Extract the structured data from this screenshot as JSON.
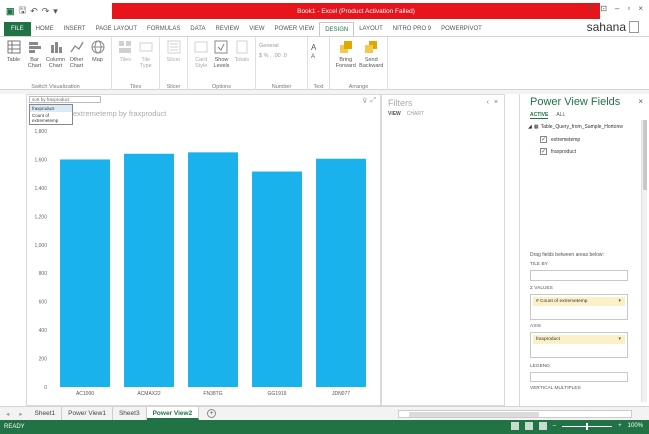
{
  "window": {
    "qat_icons": [
      "excel-icon",
      "save-icon",
      "undo-icon",
      "redo-icon"
    ],
    "title": "Book1 - Excel (Product Activation Failed)",
    "controls": [
      "?",
      "⊡",
      "–",
      "🗗",
      "×"
    ]
  },
  "tabs": [
    "FILE",
    "HOME",
    "INSERT",
    "PAGE LAYOUT",
    "FORMULAS",
    "DATA",
    "REVIEW",
    "VIEW",
    "POWER VIEW",
    "DESIGN",
    "LAYOUT",
    "NITRO PRO 9",
    "POWERPIVOT"
  ],
  "active_tab": "DESIGN",
  "user": "sahana",
  "ribbon": {
    "switch_visualization": {
      "name": "Switch Visualization",
      "buttons": [
        {
          "label": "Table",
          "sub": ""
        },
        {
          "label": "Bar",
          "sub": "Chart"
        },
        {
          "label": "Column",
          "sub": "Chart"
        },
        {
          "label": "Other",
          "sub": "Chart"
        },
        {
          "label": "Map",
          "sub": ""
        }
      ]
    },
    "tiles": {
      "name": "Tiles",
      "buttons": [
        {
          "label": "Tiles",
          "sub": ""
        },
        {
          "label": "Tile",
          "sub": "Type"
        }
      ]
    },
    "slicer": {
      "name": "Slicer",
      "buttons": [
        {
          "label": "Slicer",
          "sub": ""
        }
      ]
    },
    "options": {
      "name": "Options",
      "buttons": [
        {
          "label": "Card",
          "sub": "Style"
        },
        {
          "label": "Show",
          "sub": "Levels"
        },
        {
          "label": "Totals",
          "sub": ""
        }
      ]
    },
    "number": {
      "name": "Number",
      "format": "General",
      "symbols": "$ % , .00 .0"
    },
    "text": {
      "name": "Text",
      "grow": "A",
      "shrink": "A"
    },
    "arrange": {
      "name": "Arrange",
      "buttons": [
        {
          "label": "Bring",
          "sub": "Forward"
        },
        {
          "label": "Send",
          "sub": "Backward"
        }
      ]
    }
  },
  "canvas": {
    "sort_dropdown": "sort by fraxproduct",
    "sort_menu": [
      "fraxproduct",
      "Count of extremetemp"
    ],
    "chart_title": "extremetemp by fraxproduct",
    "icons": [
      "filter-icon",
      "popout-icon"
    ]
  },
  "chart_data": {
    "type": "bar",
    "categories": [
      "AC1000",
      "ACMAX22",
      "FN38TG",
      "GG1919",
      "JDN077"
    ],
    "values": [
      1600,
      1640,
      1650,
      1515,
      1605
    ],
    "title": "extremetemp by fraxproduct",
    "xlabel": "",
    "ylabel": "",
    "ylim": [
      0,
      1800
    ],
    "yticks": [
      "0",
      "200",
      "400",
      "600",
      "800",
      "1,000",
      "1,200",
      "1,400",
      "1,600",
      "1,800"
    ],
    "color": "#1ab2ec",
    "grid": false
  },
  "filters": {
    "title": "Filters",
    "view": "VIEW",
    "chart": "CHART",
    "controls": [
      "‹",
      "×"
    ]
  },
  "fields": {
    "title": "Power View Fields",
    "tab_active": "ACTIVE",
    "tab_all": "ALL",
    "table": "Table_Query_from_Sample_Hortonw",
    "items": [
      {
        "name": "extremetemp",
        "checked": true
      },
      {
        "name": "fraxproduct",
        "checked": true
      }
    ],
    "drag_hint": "Drag fields between areas below:",
    "tile_by": "TILE BY",
    "values": "Σ VALUES",
    "values_field": "# Count of extremetemp",
    "axis": "AXIS",
    "axis_field": "fraxproduct",
    "legend": "LEGEND",
    "vertical_multiples": "VERTICAL MULTIPLES"
  },
  "sheets": {
    "tabs": [
      "Sheet1",
      "Power View1",
      "Sheet3",
      "Power View2"
    ],
    "active": "Power View2"
  },
  "status": {
    "ready": "READY",
    "zoom": "100%"
  }
}
